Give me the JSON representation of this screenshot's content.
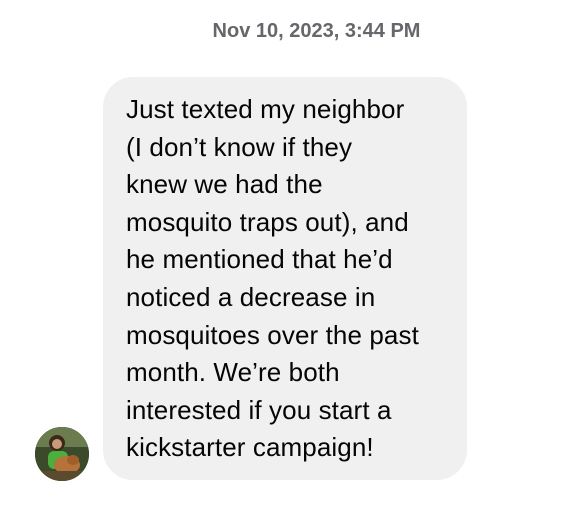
{
  "conversation": {
    "timestamp": "Nov 10, 2023, 3:44 PM",
    "messages": [
      {
        "direction": "received",
        "text": "Just texted my neighbor\n(I don’t know if they\nknew we had the\nmosquito traps out), and\nhe mentioned that he’d\nnoticed a decrease in\nmosquitoes over the past\nmonth. We’re both\ninterested if you start a\nkickstarter campaign!"
      }
    ]
  },
  "colors": {
    "bubble_background": "#f0f0f0",
    "timestamp_text": "#65676b",
    "message_text": "#050505"
  }
}
